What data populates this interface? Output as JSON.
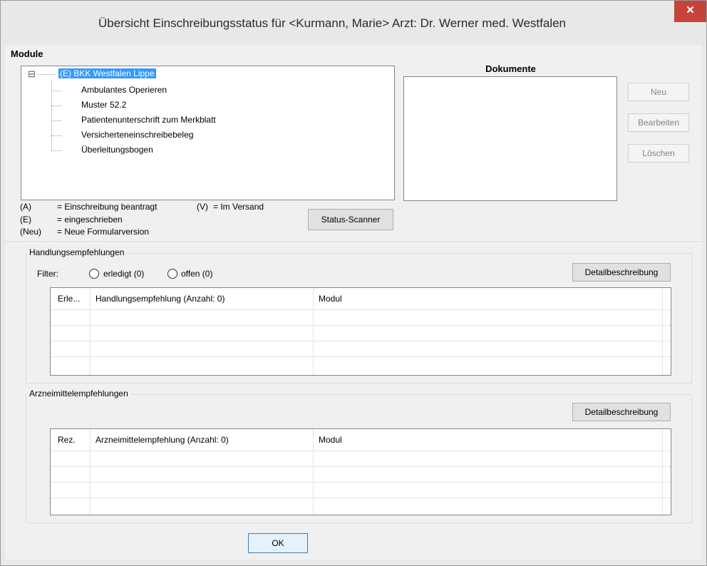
{
  "window": {
    "title": "Übersicht Einschreibungsstatus für <Kurmann, Marie> Arzt: Dr. Werner med. Westfalen",
    "close": "✕"
  },
  "module": {
    "label": "Module",
    "expander": "⊟",
    "root": "(E) BKK Westfalen Lippe",
    "children": [
      "Ambulantes Operieren",
      "Muster 52.2",
      "Patientenunterschrift zum Merkblatt",
      "Versicherteneinschreibebeleg",
      "Überleitungsbogen"
    ]
  },
  "legend": {
    "a_key": "(A)",
    "a_val": "= Einschreibung beantragt",
    "v_key": "(V)",
    "v_val": "= Im Versand",
    "e_key": "(E)",
    "e_val": "= eingeschrieben",
    "neu_key": "(Neu)",
    "neu_val": "= Neue Formularversion"
  },
  "status_scanner": "Status-Scanner",
  "dokumente": {
    "label": "Dokumente",
    "buttons": {
      "neu": "Neu",
      "bearbeiten": "Bearbeiten",
      "loeschen": "Löschen"
    }
  },
  "handlung": {
    "label": "Handlungsempfehlungen",
    "filter_label": "Filter:",
    "radio_done": "erledigt (0)",
    "radio_open": "offen (0)",
    "detail": "Detailbeschreibung",
    "columns": [
      "Erle...",
      "Handlungsempfehlung (Anzahl: 0)",
      "Modul"
    ]
  },
  "arznei": {
    "label": "Arzneimittelempfehlungen",
    "detail": "Detailbeschreibung",
    "columns": [
      "Rez.",
      "Arzneimittelempfehlung (Anzahl: 0)",
      "Modul"
    ]
  },
  "ok": "OK",
  "colors": {
    "selection": "#3399ff",
    "close": "#c74239"
  }
}
